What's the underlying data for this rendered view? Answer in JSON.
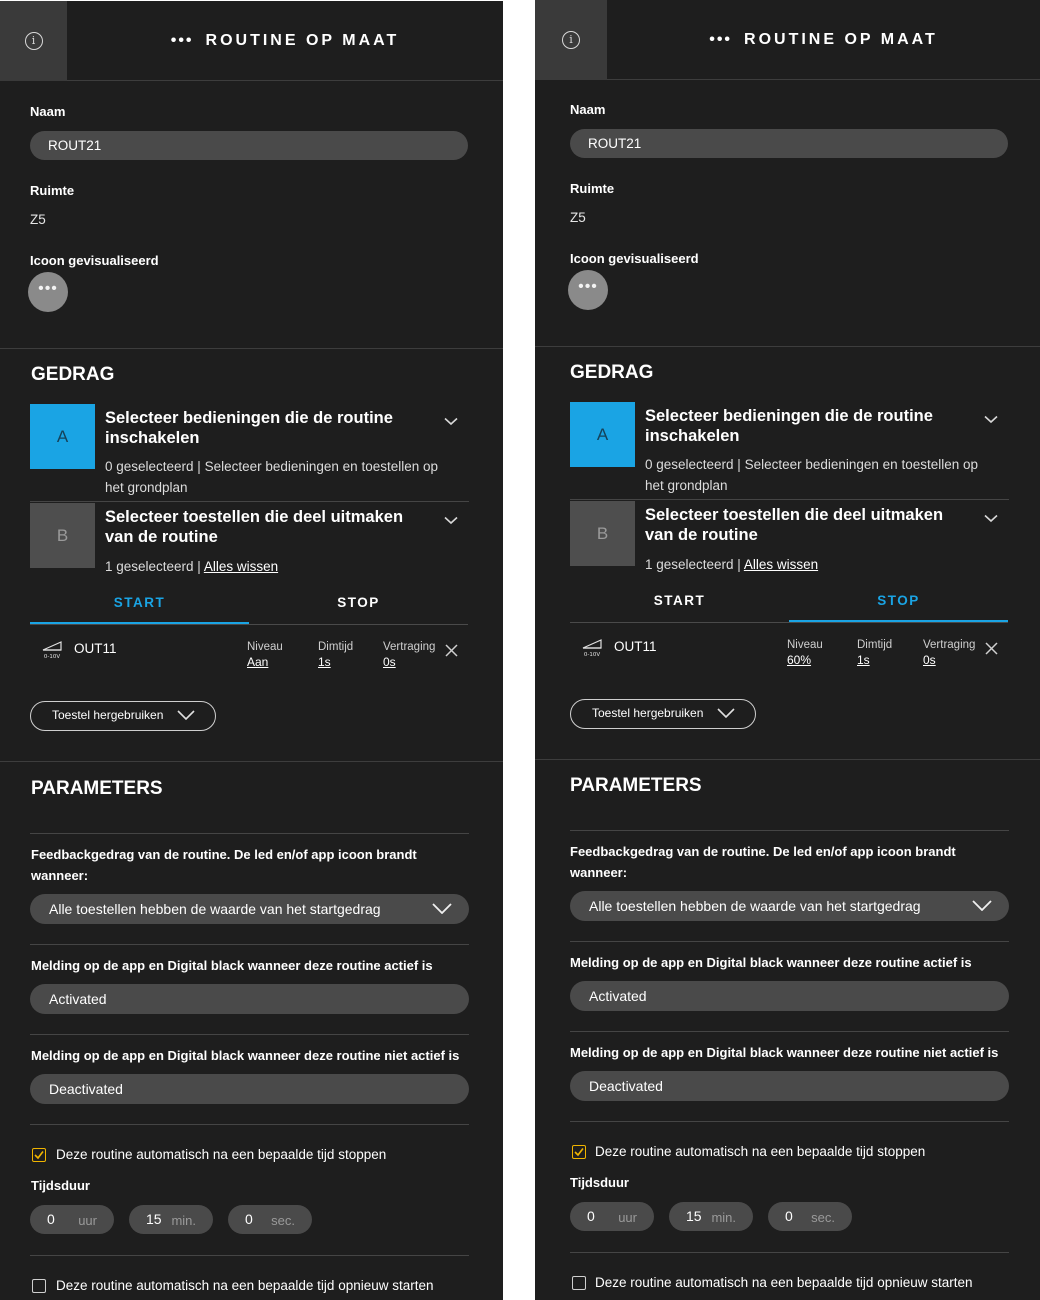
{
  "panels": [
    {
      "title": "ROUTINE OP MAAT",
      "title_dots": "•••",
      "info_icon": "i",
      "naam_label": "Naam",
      "naam_value": "ROUT21",
      "ruimte_label": "Ruimte",
      "ruimte_value": "Z5",
      "icoon_label": "Icoon gevisualiseerd",
      "icoon_dots": "•••",
      "gedrag_title": "GEDRAG",
      "acc_a": {
        "letter": "A",
        "title": "Selecteer bedieningen die de routine inschakelen",
        "sub": "0 geselecteerd | Selecteer bedieningen en toestellen op het grondplan"
      },
      "acc_b": {
        "letter": "B",
        "title": "Selecteer toestellen die deel uitmaken van de routine",
        "sub_prefix": "1 geselecteerd | ",
        "sub_link": "Alles wissen"
      },
      "tabs": {
        "start": "START",
        "stop": "STOP",
        "active": "start"
      },
      "device": {
        "icon_caption": "0-10V",
        "name": "OUT11",
        "niveau_label": "Niveau",
        "niveau_value": "Aan",
        "dimtijd_label": "Dimtijd",
        "dimtijd_value": "1s",
        "vertraging_label": "Vertraging",
        "vertraging_value": "0s"
      },
      "reuse_label": "Toestel hergebruiken",
      "parameters_title": "PARAMETERS",
      "feedback_label": "Feedbackgedrag van de routine. De led en/of app icoon brandt wanneer:",
      "feedback_value": "Alle toestellen hebben de waarde van het startgedrag",
      "melding_actief_label": "Melding op de app en Digital black wanneer deze routine actief is",
      "melding_actief_value": "Activated",
      "melding_niet_label": "Melding op de app en Digital black wanneer deze routine niet actief is",
      "melding_niet_value": "Deactivated",
      "auto_stop_label": "Deze routine automatisch na een bepaalde tijd stoppen",
      "auto_stop_checked": true,
      "tijdsduur_label": "Tijdsduur",
      "duration": [
        {
          "value": "0",
          "unit": "uur"
        },
        {
          "value": "15",
          "unit": "min."
        },
        {
          "value": "0",
          "unit": "sec."
        }
      ],
      "auto_restart_label": "Deze routine automatisch na een bepaalde tijd opnieuw starten",
      "auto_restart_checked": false
    },
    {
      "title": "ROUTINE OP MAAT",
      "title_dots": "•••",
      "info_icon": "i",
      "naam_label": "Naam",
      "naam_value": "ROUT21",
      "ruimte_label": "Ruimte",
      "ruimte_value": "Z5",
      "icoon_label": "Icoon gevisualiseerd",
      "icoon_dots": "•••",
      "gedrag_title": "GEDRAG",
      "acc_a": {
        "letter": "A",
        "title": "Selecteer bedieningen die de routine inschakelen",
        "sub": "0 geselecteerd | Selecteer bedieningen en toestellen op het grondplan"
      },
      "acc_b": {
        "letter": "B",
        "title": "Selecteer toestellen die deel uitmaken van de routine",
        "sub_prefix": "1 geselecteerd | ",
        "sub_link": "Alles wissen"
      },
      "tabs": {
        "start": "START",
        "stop": "STOP",
        "active": "stop"
      },
      "device": {
        "icon_caption": "0-10V",
        "name": "OUT11",
        "niveau_label": "Niveau",
        "niveau_value": "60%",
        "dimtijd_label": "Dimtijd",
        "dimtijd_value": "1s",
        "vertraging_label": "Vertraging",
        "vertraging_value": "0s"
      },
      "reuse_label": "Toestel hergebruiken",
      "parameters_title": "PARAMETERS",
      "feedback_label": "Feedbackgedrag van de routine. De led en/of app icoon brandt wanneer:",
      "feedback_value": "Alle toestellen hebben de waarde van het startgedrag",
      "melding_actief_label": "Melding op de app en Digital black wanneer deze routine actief is",
      "melding_actief_value": "Activated",
      "melding_niet_label": "Melding op de app en Digital black wanneer deze routine niet actief is",
      "melding_niet_value": "Deactivated",
      "auto_stop_label": "Deze routine automatisch na een bepaalde tijd stoppen",
      "auto_stop_checked": true,
      "tijdsduur_label": "Tijdsduur",
      "duration": [
        {
          "value": "0",
          "unit": "uur"
        },
        {
          "value": "15",
          "unit": "min."
        },
        {
          "value": "0",
          "unit": "sec."
        }
      ],
      "auto_restart_label": "Deze routine automatisch na een bepaalde tijd opnieuw starten",
      "auto_restart_checked": false
    }
  ],
  "colors": {
    "background": "#1e1e1e",
    "accent": "#1aa4e4",
    "checkbox_checked": "#f0b400",
    "pill": "#4a4a4a"
  }
}
